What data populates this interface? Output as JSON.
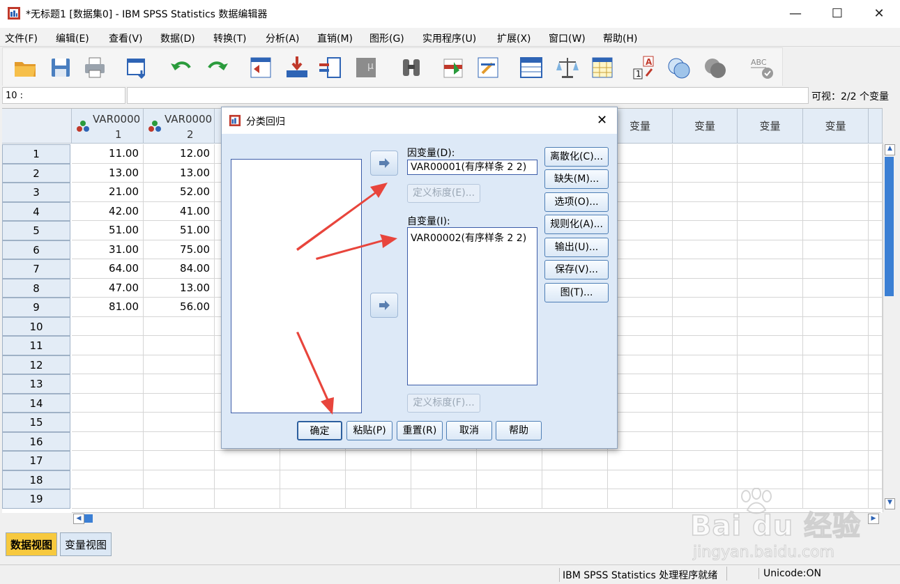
{
  "window": {
    "title": "*无标题1 [数据集0] - IBM SPSS Statistics 数据编辑器",
    "min_glyph": "—",
    "max_glyph": "☐",
    "close_glyph": "✕"
  },
  "menu": [
    "文件(F)",
    "编辑(E)",
    "查看(V)",
    "数据(D)",
    "转换(T)",
    "分析(A)",
    "直销(M)",
    "图形(G)",
    "实用程序(U)",
    "扩展(X)",
    "窗口(W)",
    "帮助(H)"
  ],
  "toolbar_icons": [
    "open-icon",
    "save-icon",
    "print-icon",
    "dialog-recall-icon",
    "undo-icon",
    "redo-icon",
    "goto-case-icon",
    "goto-variable-icon",
    "variables-icon",
    "run-descriptives-icon",
    "find-icon",
    "insert-cases-icon",
    "insert-variable-icon",
    "split-file-icon",
    "weight-cases-icon",
    "select-cases-icon",
    "value-labels-icon",
    "use-sets-icon",
    "show-all-variables-icon",
    "spell-check-icon"
  ],
  "cellbar": {
    "ref": "10 :",
    "value": "",
    "visible": "可视：2/2 个变量"
  },
  "grid": {
    "columns": [
      {
        "name_line1": "VAR0000",
        "name_line2": "1"
      },
      {
        "name_line1": "VAR0000",
        "name_line2": "2"
      }
    ],
    "empty_header": "变量",
    "rows": [
      {
        "n": "1",
        "v1": "11.00",
        "v2": "12.00"
      },
      {
        "n": "2",
        "v1": "13.00",
        "v2": "13.00"
      },
      {
        "n": "3",
        "v1": "21.00",
        "v2": "52.00"
      },
      {
        "n": "4",
        "v1": "42.00",
        "v2": "41.00"
      },
      {
        "n": "5",
        "v1": "51.00",
        "v2": "51.00"
      },
      {
        "n": "6",
        "v1": "31.00",
        "v2": "75.00"
      },
      {
        "n": "7",
        "v1": "64.00",
        "v2": "84.00"
      },
      {
        "n": "8",
        "v1": "47.00",
        "v2": "13.00"
      },
      {
        "n": "9",
        "v1": "81.00",
        "v2": "56.00"
      },
      {
        "n": "10",
        "v1": "",
        "v2": ""
      },
      {
        "n": "11",
        "v1": "",
        "v2": ""
      },
      {
        "n": "12",
        "v1": "",
        "v2": ""
      },
      {
        "n": "13",
        "v1": "",
        "v2": ""
      },
      {
        "n": "14",
        "v1": "",
        "v2": ""
      },
      {
        "n": "15",
        "v1": "",
        "v2": ""
      },
      {
        "n": "16",
        "v1": "",
        "v2": ""
      },
      {
        "n": "17",
        "v1": "",
        "v2": ""
      },
      {
        "n": "18",
        "v1": "",
        "v2": ""
      },
      {
        "n": "19",
        "v1": "",
        "v2": ""
      }
    ]
  },
  "tabs": {
    "data_view": "数据视图",
    "variable_view": "变量视图"
  },
  "status": {
    "processor": "IBM SPSS Statistics 处理程序就绪",
    "unicode": "Unicode:ON"
  },
  "dialog": {
    "title": "分类回归",
    "close_glyph": "✕",
    "dependent_label": "因变量(D):",
    "dependent_value": "VAR00001(有序样条 2 2)",
    "define_scale_top": "定义标度(E)...",
    "independent_label": "自变量(I):",
    "independent_value": "VAR00002(有序样条 2 2)",
    "define_scale_bottom": "定义标度(F)...",
    "side_buttons": [
      "离散化(C)...",
      "缺失(M)...",
      "选项(O)...",
      "规则化(A)...",
      "输出(U)...",
      "保存(V)...",
      "图(T)..."
    ],
    "bottom_buttons": [
      "确定",
      "粘贴(P)",
      "重置(R)",
      "取消",
      "帮助"
    ]
  },
  "watermark": {
    "brand": "Bai du 经验",
    "url": "jingyan.baidu.com"
  },
  "colors": {
    "accent": "#3b5ca8",
    "dialog_bg": "#dde9f7",
    "header_bg": "#e3ecf6",
    "annotation_arrow": "#e8453c",
    "active_tab": "#f7c93e"
  }
}
